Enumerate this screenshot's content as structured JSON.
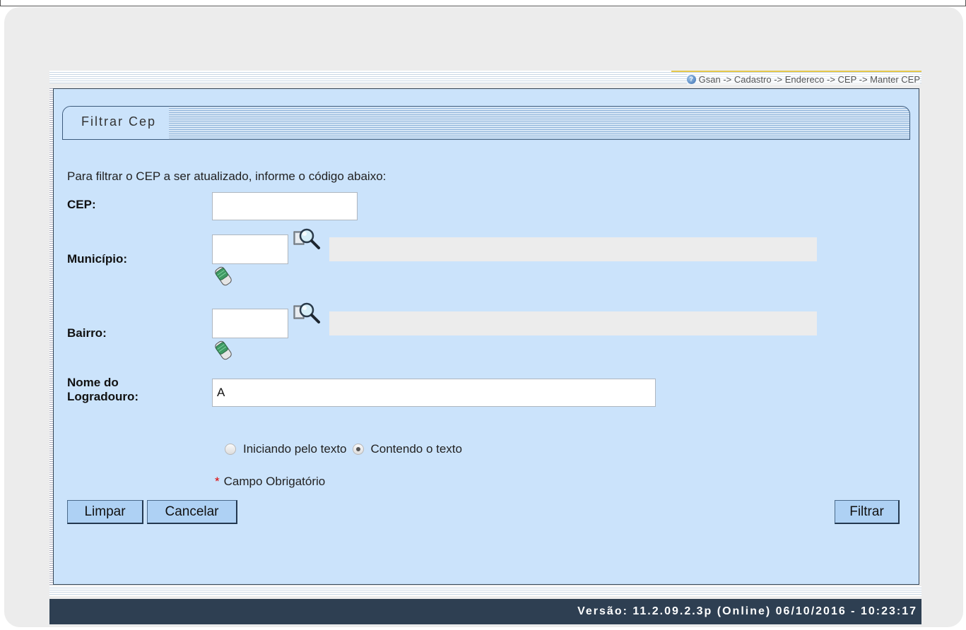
{
  "breadcrumb": {
    "text": "Gsan -> Cadastro -> Endereco -> CEP -> Manter CEP"
  },
  "panel": {
    "title": "Filtrar Cep",
    "instruction": "Para filtrar o CEP a ser atualizado, informe o código abaixo:"
  },
  "fields": {
    "cep": {
      "label": "CEP:",
      "value": ""
    },
    "municipio": {
      "label": "Município:",
      "code_value": "",
      "description_value": ""
    },
    "bairro": {
      "label": "Bairro:",
      "code_value": "",
      "description_value": ""
    },
    "logradouro": {
      "label_line1": "Nome do",
      "label_line2": "Logradouro:",
      "value": "A"
    }
  },
  "search_type": {
    "options": [
      "Iniciando pelo texto",
      "Contendo o texto"
    ],
    "selected": "Contendo o texto"
  },
  "required_note": {
    "star": "*",
    "text": "Campo Obrigatório"
  },
  "buttons": {
    "limpar": "Limpar",
    "cancelar": "Cancelar",
    "filtrar": "Filtrar"
  },
  "footer": {
    "version_text": "Versão: 11.2.09.2.3p (Online) 06/10/2016 - 10:23:17"
  },
  "icons": {
    "help": "help-icon",
    "search": "magnifier-search-icon",
    "eraser": "eraser-icon"
  },
  "colors": {
    "panel_bg": "#cbe3fb",
    "button_bg": "#aed1f4",
    "footer_bg": "#2e3f52",
    "required_star": "#dd0000"
  }
}
